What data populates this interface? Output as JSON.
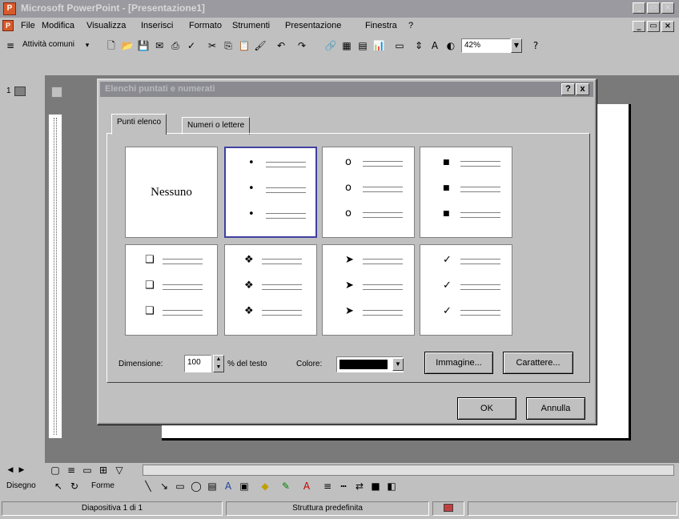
{
  "app": {
    "title": "Microsoft PowerPoint - [Presentazione1]",
    "window_buttons": [
      "_",
      "Ĉ",
      "x"
    ]
  },
  "menu": {
    "items": [
      "File",
      "Modifica",
      "Visualizza",
      "Inserisci",
      "Formato",
      "Strumenti",
      "Presentazione",
      "Finestra",
      "?"
    ]
  },
  "toolbar": {
    "tasks_label": "Attività comuni",
    "zoom": "42%"
  },
  "slide": {
    "number": "1"
  },
  "dialog": {
    "title": "Elenchi puntati e numerati",
    "help_button": "?",
    "close_button": "x",
    "tabs": [
      "Punti elenco",
      "Numeri o lettere"
    ],
    "active_tab": "Punti elenco",
    "none_label": "Nessuno",
    "bullet_styles": [
      {
        "glyph": "•"
      },
      {
        "glyph": "o"
      },
      {
        "glyph": "■"
      },
      {
        "glyph": "❑"
      },
      {
        "glyph": "❖"
      },
      {
        "glyph": "➤"
      },
      {
        "glyph": "✓"
      }
    ],
    "size_label": "Dimensione:",
    "size_value": "100",
    "size_suffix": "% del testo",
    "color_label": "Colore:",
    "color_value": "#000000",
    "image_button": "Immagine...",
    "char_button": "Carattere...",
    "ok_button": "OK",
    "cancel_button": "Annulla"
  },
  "drawing": {
    "draw_label": "Disegno",
    "shapes_label": "Forme"
  },
  "status": {
    "slide": "Diapositiva 1 di 1",
    "design": "Struttura predefinita"
  }
}
